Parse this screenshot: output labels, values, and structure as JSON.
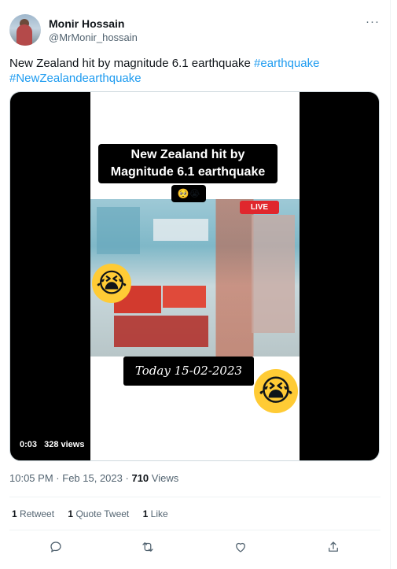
{
  "author": {
    "name": "Monir Hossain",
    "handle": "@MrMonir_hossain"
  },
  "tweet": {
    "text": "New Zealand hit by magnitude 6.1 earthquake",
    "hashtags": [
      "#earthquake",
      "#NewZealandearthquake"
    ]
  },
  "video": {
    "overlay_title": "New Zealand hit by Magnitude 6.1 earthquake",
    "live_badge": "LIVE",
    "date_caption": "Today 15-02-2023",
    "time": "0:03",
    "views": "328 views"
  },
  "meta": {
    "time": "10:05 PM",
    "date": "Feb 15, 2023",
    "views_count": "710",
    "views_label": "Views",
    "separator": "·"
  },
  "stats": [
    {
      "count": "1",
      "label": "Retweet"
    },
    {
      "count": "1",
      "label": "Quote Tweet"
    },
    {
      "count": "1",
      "label": "Like"
    }
  ],
  "icons": {
    "more": "more-horizontal-icon",
    "reply": "reply-icon",
    "retweet": "retweet-icon",
    "like": "heart-icon",
    "share": "share-icon"
  },
  "colors": {
    "link": "#1d9bf0",
    "secondary_text": "#536471",
    "live": "#e0272d"
  }
}
